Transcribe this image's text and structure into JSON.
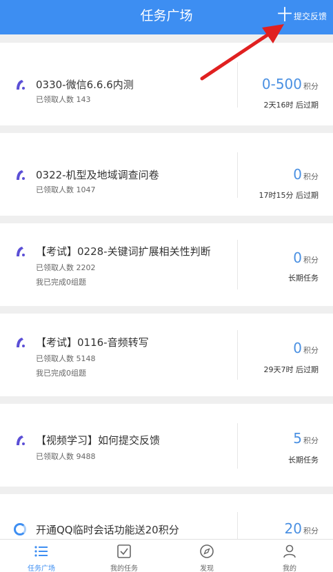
{
  "header": {
    "title": "任务广场",
    "feedback_plus": "十",
    "feedback_label": "提交反馈"
  },
  "tasks": [
    {
      "icon": "tick-arc-icon",
      "name": "0330-微信6.6.6内测",
      "claimed": "已领取人数 143",
      "completed": "",
      "points": "0-500",
      "points_unit": "积分",
      "expire": "2天16时 后过期"
    },
    {
      "icon": "tick-arc-icon",
      "name": "0322-机型及地域调查问卷",
      "claimed": "已领取人数 1047",
      "completed": "",
      "points": "0",
      "points_unit": "积分",
      "expire": "17时15分 后过期"
    },
    {
      "icon": "tick-arc-icon",
      "name": "【考试】0228-关键词扩展相关性判断",
      "claimed": "已领取人数 2202",
      "completed": "我已完成0组题",
      "points": "0",
      "points_unit": "积分",
      "expire": "长期任务"
    },
    {
      "icon": "tick-arc-icon",
      "name": "【考试】0116-音频转写",
      "claimed": "已领取人数 5148",
      "completed": "我已完成0组题",
      "points": "0",
      "points_unit": "积分",
      "expire": "29天7时 后过期"
    },
    {
      "icon": "tick-arc-icon",
      "name": "【视频学习】如何提交反馈",
      "claimed": "已领取人数 9488",
      "completed": "",
      "points": "5",
      "points_unit": "积分",
      "expire": "长期任务"
    },
    {
      "icon": "qq-swirl-icon",
      "name": "开通QQ临时会话功能送20积分",
      "claimed": "",
      "completed": "",
      "points": "20",
      "points_unit": "积分",
      "expire": ""
    }
  ],
  "tabs": [
    {
      "icon": "list-icon",
      "label": "任务广场",
      "active": true
    },
    {
      "icon": "checkbox-icon",
      "label": "我的任务",
      "active": false
    },
    {
      "icon": "compass-icon",
      "label": "发现",
      "active": false
    },
    {
      "icon": "person-icon",
      "label": "我的",
      "active": false
    }
  ],
  "colors": {
    "brand": "#3d8ef2",
    "points": "#4a90e2",
    "annotation_arrow": "#e02020",
    "task_icon": "#5b4fd6"
  }
}
